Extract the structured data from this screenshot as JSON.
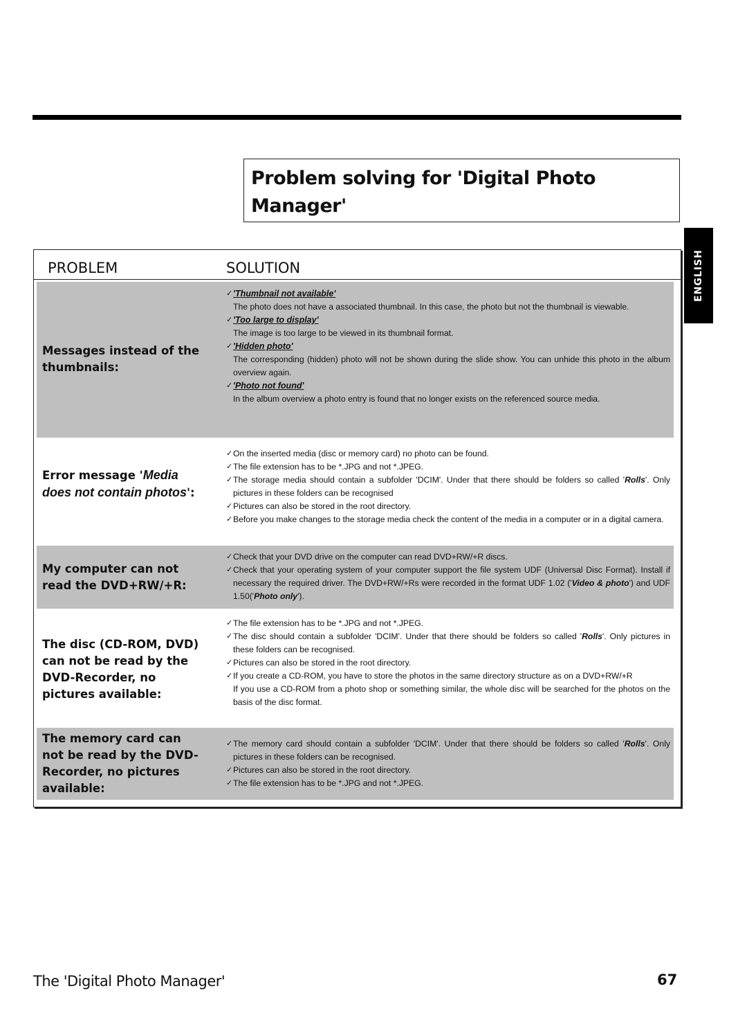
{
  "page": {
    "title": "Problem solving for 'Digital Photo Manager'",
    "language_tab": "ENGLISH",
    "footer_title": "The 'Digital Photo Manager'",
    "page_number": "67"
  },
  "table": {
    "header_problem": "PROBLEM",
    "header_solution": "SOLUTION",
    "row_fill_color": "#bfbfbf",
    "rows": [
      {
        "problem": "Messages instead of the thumbnails:",
        "solutions": [
          {
            "check": "✓",
            "heading": "'Thumbnail not available'",
            "text": "The photo does not have a associated thumbnail. In this case, the photo but not the thumbnail is viewable."
          },
          {
            "check": "✓",
            "heading": "'Too large to display'",
            "text": "The image is too large to be viewed in its thumbnail format."
          },
          {
            "check": "✓",
            "heading": "'Hidden photo'",
            "text": "The corresponding (hidden) photo will not be shown during the slide show. You can unhide this photo in the album overview again."
          },
          {
            "check": "✓",
            "heading": "'Photo not found'",
            "text": "In the album overview a photo entry is found that no longer exists on the referenced source media."
          }
        ]
      },
      {
        "problem_pre": "Error message '",
        "problem_em": "Media does not contain photos",
        "problem_post": "':",
        "solutions": [
          {
            "check": "✓",
            "text": "On the inserted media (disc or memory card) no photo can be found."
          },
          {
            "check": "✓",
            "text": "The file extension has to be *.JPG and not *.JPEG."
          },
          {
            "check": "✓",
            "text_pre": "The storage media should contain a subfolder 'DCIM'. Under that there should be folders so called '",
            "em": "Rolls",
            "text_post": "'. Only pictures in these folders can be recognised"
          },
          {
            "check": "✓",
            "text": "Pictures can also be stored in the root directory."
          },
          {
            "check": "✓",
            "text": "Before you make changes to the storage media check the content of the media in a computer or in a digital camera."
          }
        ]
      },
      {
        "problem": "My computer can not read the DVD+RW/+R:",
        "solutions": [
          {
            "check": "✓",
            "text": "Check that your DVD drive on the computer can read DVD+RW/+R discs."
          },
          {
            "check": "✓",
            "text_pre": "Check that your operating system of your computer support the file system UDF (Universal Disc Format). Install if necessary the required driver. The DVD+RW/+Rs were recorded in the format UDF 1.02 ('",
            "em1": "Video & photo",
            "text_mid": "') and UDF 1.50('",
            "em2": "Photo only",
            "text_post": "')."
          }
        ]
      },
      {
        "problem": "The disc (CD-ROM, DVD) can not be read by the DVD-Recorder, no pictures available:",
        "solutions": [
          {
            "check": "✓",
            "text": "The file extension has to be *.JPG and not *.JPEG."
          },
          {
            "check": "✓",
            "text_pre": "The disc should contain a subfolder 'DCIM'. Under that there should be folders so called '",
            "em": "Rolls",
            "text_post": "'. Only pictures in these folders can be recognised."
          },
          {
            "check": "✓",
            "text": "Pictures can also be stored in the root directory."
          },
          {
            "check": "✓",
            "text": "If you create a CD-ROM, you have to store the photos in the same directory structure as on a DVD+RW/+R"
          },
          {
            "text": "If you use a CD-ROM from a photo shop or something similar, the whole disc will be searched for the photos on the basis of the disc format."
          }
        ]
      },
      {
        "problem": "The memory card can not be read by the DVD-Recorder, no pictures available:",
        "solutions": [
          {
            "check": "✓",
            "text_pre": "The memory card should contain a subfolder 'DCIM'. Under that there should be folders so called '",
            "em": "Rolls",
            "text_post": "'. Only pictures in these folders can be recognised."
          },
          {
            "check": "✓",
            "text": "Pictures can also be stored in the root directory."
          },
          {
            "check": "✓",
            "text": "The file extension has to be *.JPG and not *.JPEG."
          }
        ]
      }
    ]
  }
}
